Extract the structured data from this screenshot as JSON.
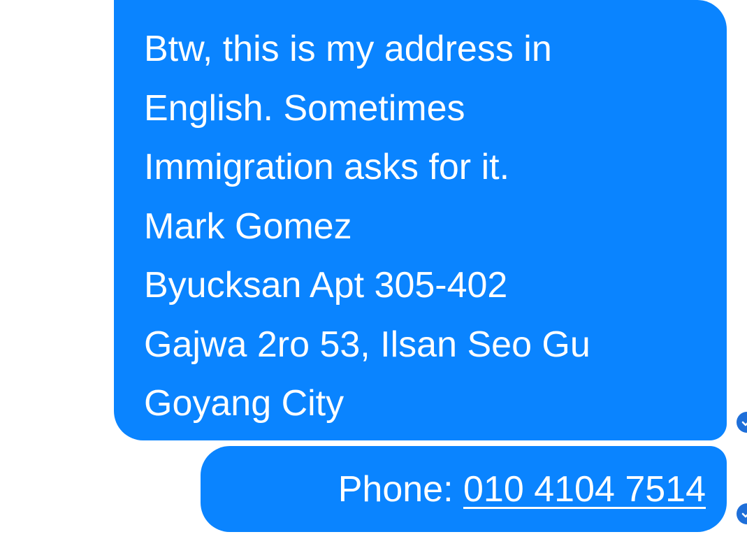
{
  "messages": [
    {
      "lines": [
        "Btw, this is my address in",
        "English. Sometimes",
        "Immigration asks for it.",
        "Mark Gomez",
        "Byucksan Apt 305-402",
        "Gajwa 2ro 53, Ilsan Seo Gu",
        "Goyang City"
      ],
      "status_icon": "delivered-check-icon"
    },
    {
      "label": "Phone: ",
      "phone": "010 4104 7514",
      "status_icon": "delivered-check-icon"
    }
  ],
  "colors": {
    "bubble": "#0a84ff",
    "text": "#ffffff",
    "background": "#ffffff",
    "status_icon": "#1e6fd9"
  }
}
